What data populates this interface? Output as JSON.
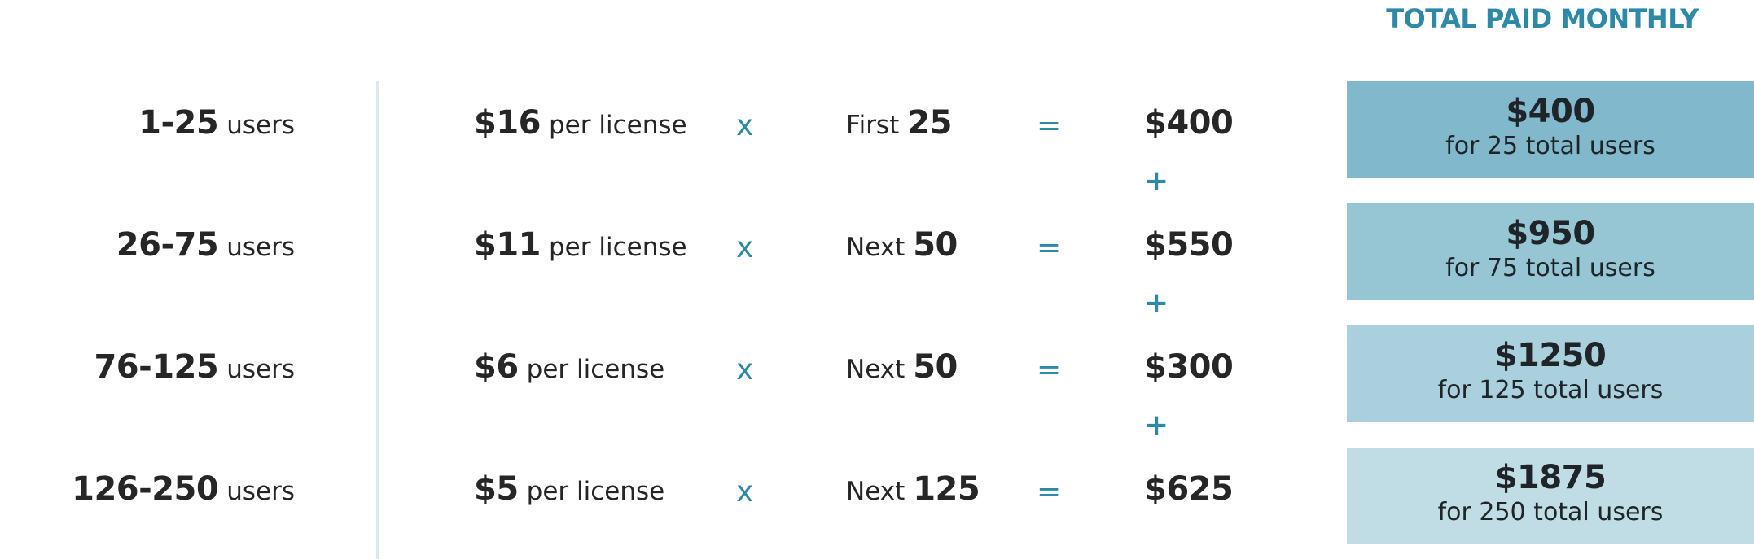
{
  "header": {
    "title": "TOTAL PAID MONTHLY"
  },
  "colors": {
    "accent": "#2e88a8",
    "text": "#262626",
    "divider": "#dde9f0",
    "box_1": "#82b8cc",
    "box_2": "#96c5d4",
    "box_3": "#aacfdd",
    "box_4": "#c0dde6"
  },
  "operators": {
    "times": "x",
    "equals": "=",
    "plus": "+"
  },
  "tiers": [
    {
      "range": "1-25",
      "range_unit": "users",
      "price": "$16",
      "price_unit": "per license",
      "qty_label": "First",
      "qty": "25",
      "subtotal": "$400",
      "total": "$400",
      "total_caption": "for 25 total users"
    },
    {
      "range": "26-75",
      "range_unit": "users",
      "price": "$11",
      "price_unit": "per license",
      "qty_label": "Next",
      "qty": "50",
      "subtotal": "$550",
      "total": "$950",
      "total_caption": "for 75 total users"
    },
    {
      "range": "76-125",
      "range_unit": "users",
      "price": "$6",
      "price_unit": "per license",
      "qty_label": "Next",
      "qty": "50",
      "subtotal": "$300",
      "total": "$1250",
      "total_caption": "for 125 total users"
    },
    {
      "range": "126-250",
      "range_unit": "users",
      "price": "$5",
      "price_unit": "per license",
      "qty_label": "Next",
      "qty": "125",
      "subtotal": "$625",
      "total": "$1875",
      "total_caption": "for 250 total users"
    }
  ]
}
